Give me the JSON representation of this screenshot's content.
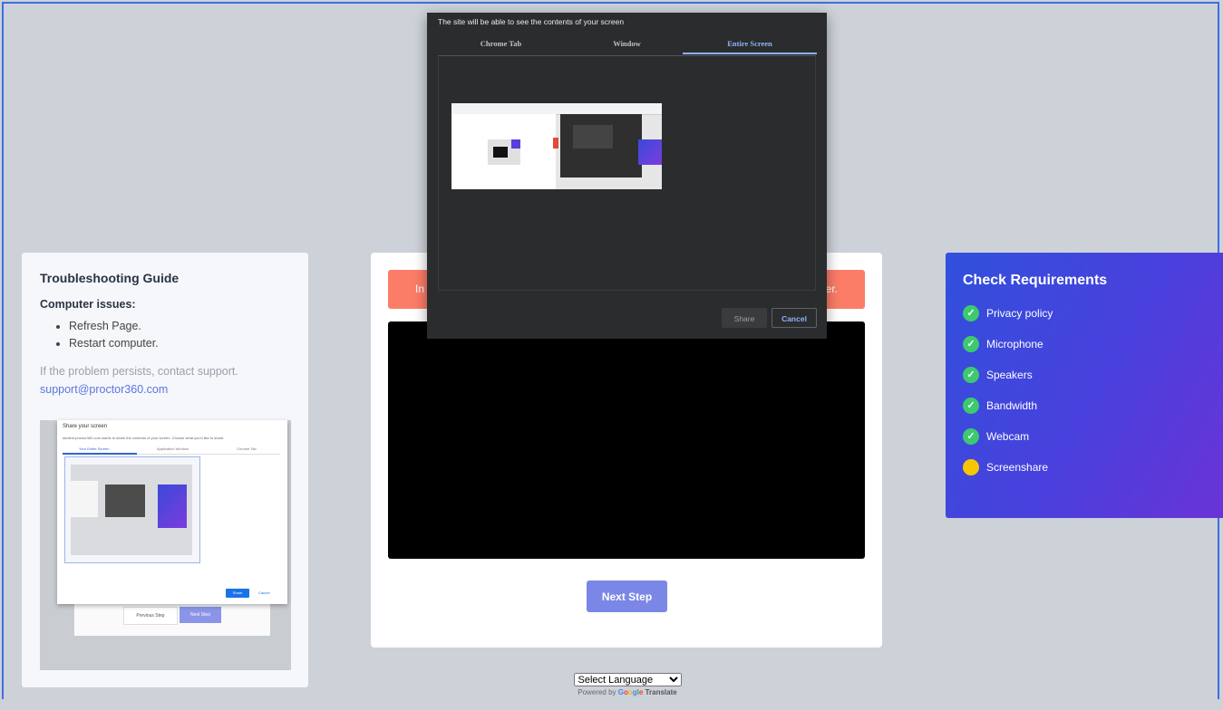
{
  "guide": {
    "title": "Troubleshooting Guide",
    "section": "Computer issues:",
    "items": [
      "Refresh Page.",
      "Restart computer."
    ],
    "note": "If the problem persists, contact support.",
    "email": "support@proctor360.com",
    "image": {
      "dialog_title": "Share your screen",
      "dialog_subtitle": "student.proctor360.com wants to share the contents of your screen. Choose what you'd like to share.",
      "tabs": [
        "Your Entire Screen",
        "Application Window",
        "Chrome Tab"
      ],
      "share_label": "Share",
      "cancel_label": "Cancel",
      "prev_label": "Previous Step",
      "next_label": "Next Step"
    }
  },
  "alert": {
    "left_text": "In",
    "right_text": "er."
  },
  "next_step_label": "Next Step",
  "share_dialog": {
    "prompt": "The site will be able to see the contents of your screen",
    "tabs": [
      "Chrome Tab",
      "Window",
      "Entire Screen"
    ],
    "active_tab": "Entire Screen",
    "share_label": "Share",
    "cancel_label": "Cancel"
  },
  "requirements": {
    "title": "Check Requirements",
    "items": [
      {
        "label": "Privacy policy",
        "status": "done"
      },
      {
        "label": "Microphone",
        "status": "done"
      },
      {
        "label": "Speakers",
        "status": "done"
      },
      {
        "label": "Bandwidth",
        "status": "done"
      },
      {
        "label": "Webcam",
        "status": "done"
      },
      {
        "label": "Screenshare",
        "status": "pending"
      }
    ],
    "done_color": "#3dc96f",
    "pending_color": "#f7c600"
  },
  "translate": {
    "selected": "Select Language",
    "powered_by": "Powered by",
    "google": "Google",
    "translate": "Translate"
  },
  "colors": {
    "accent": "#7a87e6",
    "alert": "#fb7d68",
    "frame": "#3b6fe0"
  },
  "icons": {
    "check": "check-circle-icon",
    "pending": "pending-circle-icon"
  }
}
